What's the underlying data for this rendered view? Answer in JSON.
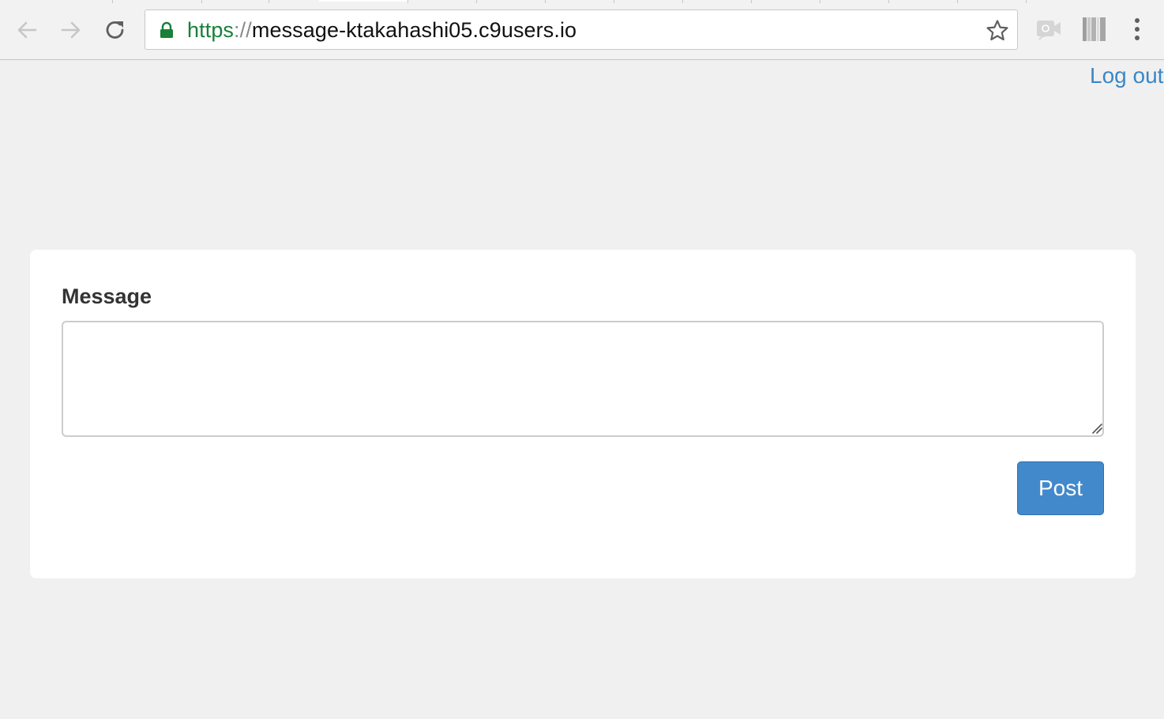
{
  "browser": {
    "url": {
      "scheme": "https",
      "separator": "://",
      "host": "message-ktakahashi05.c9users.io"
    },
    "icons": {
      "back": "back-arrow-icon",
      "forward": "forward-arrow-icon",
      "reload": "reload-icon",
      "secure": "lock-icon",
      "bookmark": "star-icon",
      "extension1": "camera-extension-icon",
      "extension2": "barcode-extension-icon",
      "menu": "kebab-menu-icon"
    },
    "colors": {
      "scheme": "#188038",
      "lock": "#188038"
    }
  },
  "header": {
    "logout_label": "Log out"
  },
  "form": {
    "message_label": "Message",
    "message_value": "",
    "post_label": "Post"
  },
  "colors": {
    "accent": "#4289cc",
    "link": "#3a87c8",
    "page_background": "#f0f0f0"
  }
}
